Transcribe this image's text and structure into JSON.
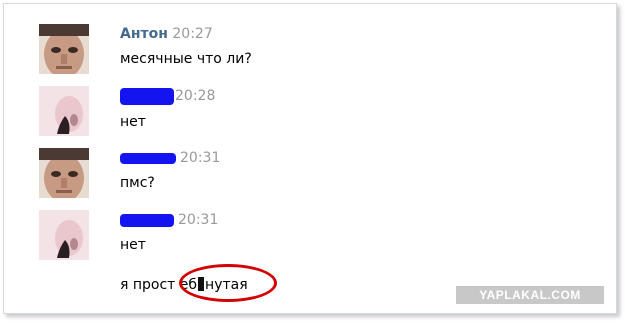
{
  "messages": [
    {
      "author": "Антон",
      "time": "20:27",
      "text": "месячные что ли?"
    },
    {
      "author": "",
      "time": "20:28",
      "text": "нет"
    },
    {
      "author": "",
      "time": "20:31",
      "text": "пмс?"
    },
    {
      "author": "",
      "time": "20:31",
      "text": "нет"
    }
  ],
  "last_line": {
    "before": "я прост",
    "after": "еб",
    "end": "нутая"
  },
  "watermark": "YAPLAKAL.COM",
  "colors": {
    "author": "#45688e",
    "time": "#999999",
    "redaction": "#1414f0",
    "circle": "#d40000"
  }
}
